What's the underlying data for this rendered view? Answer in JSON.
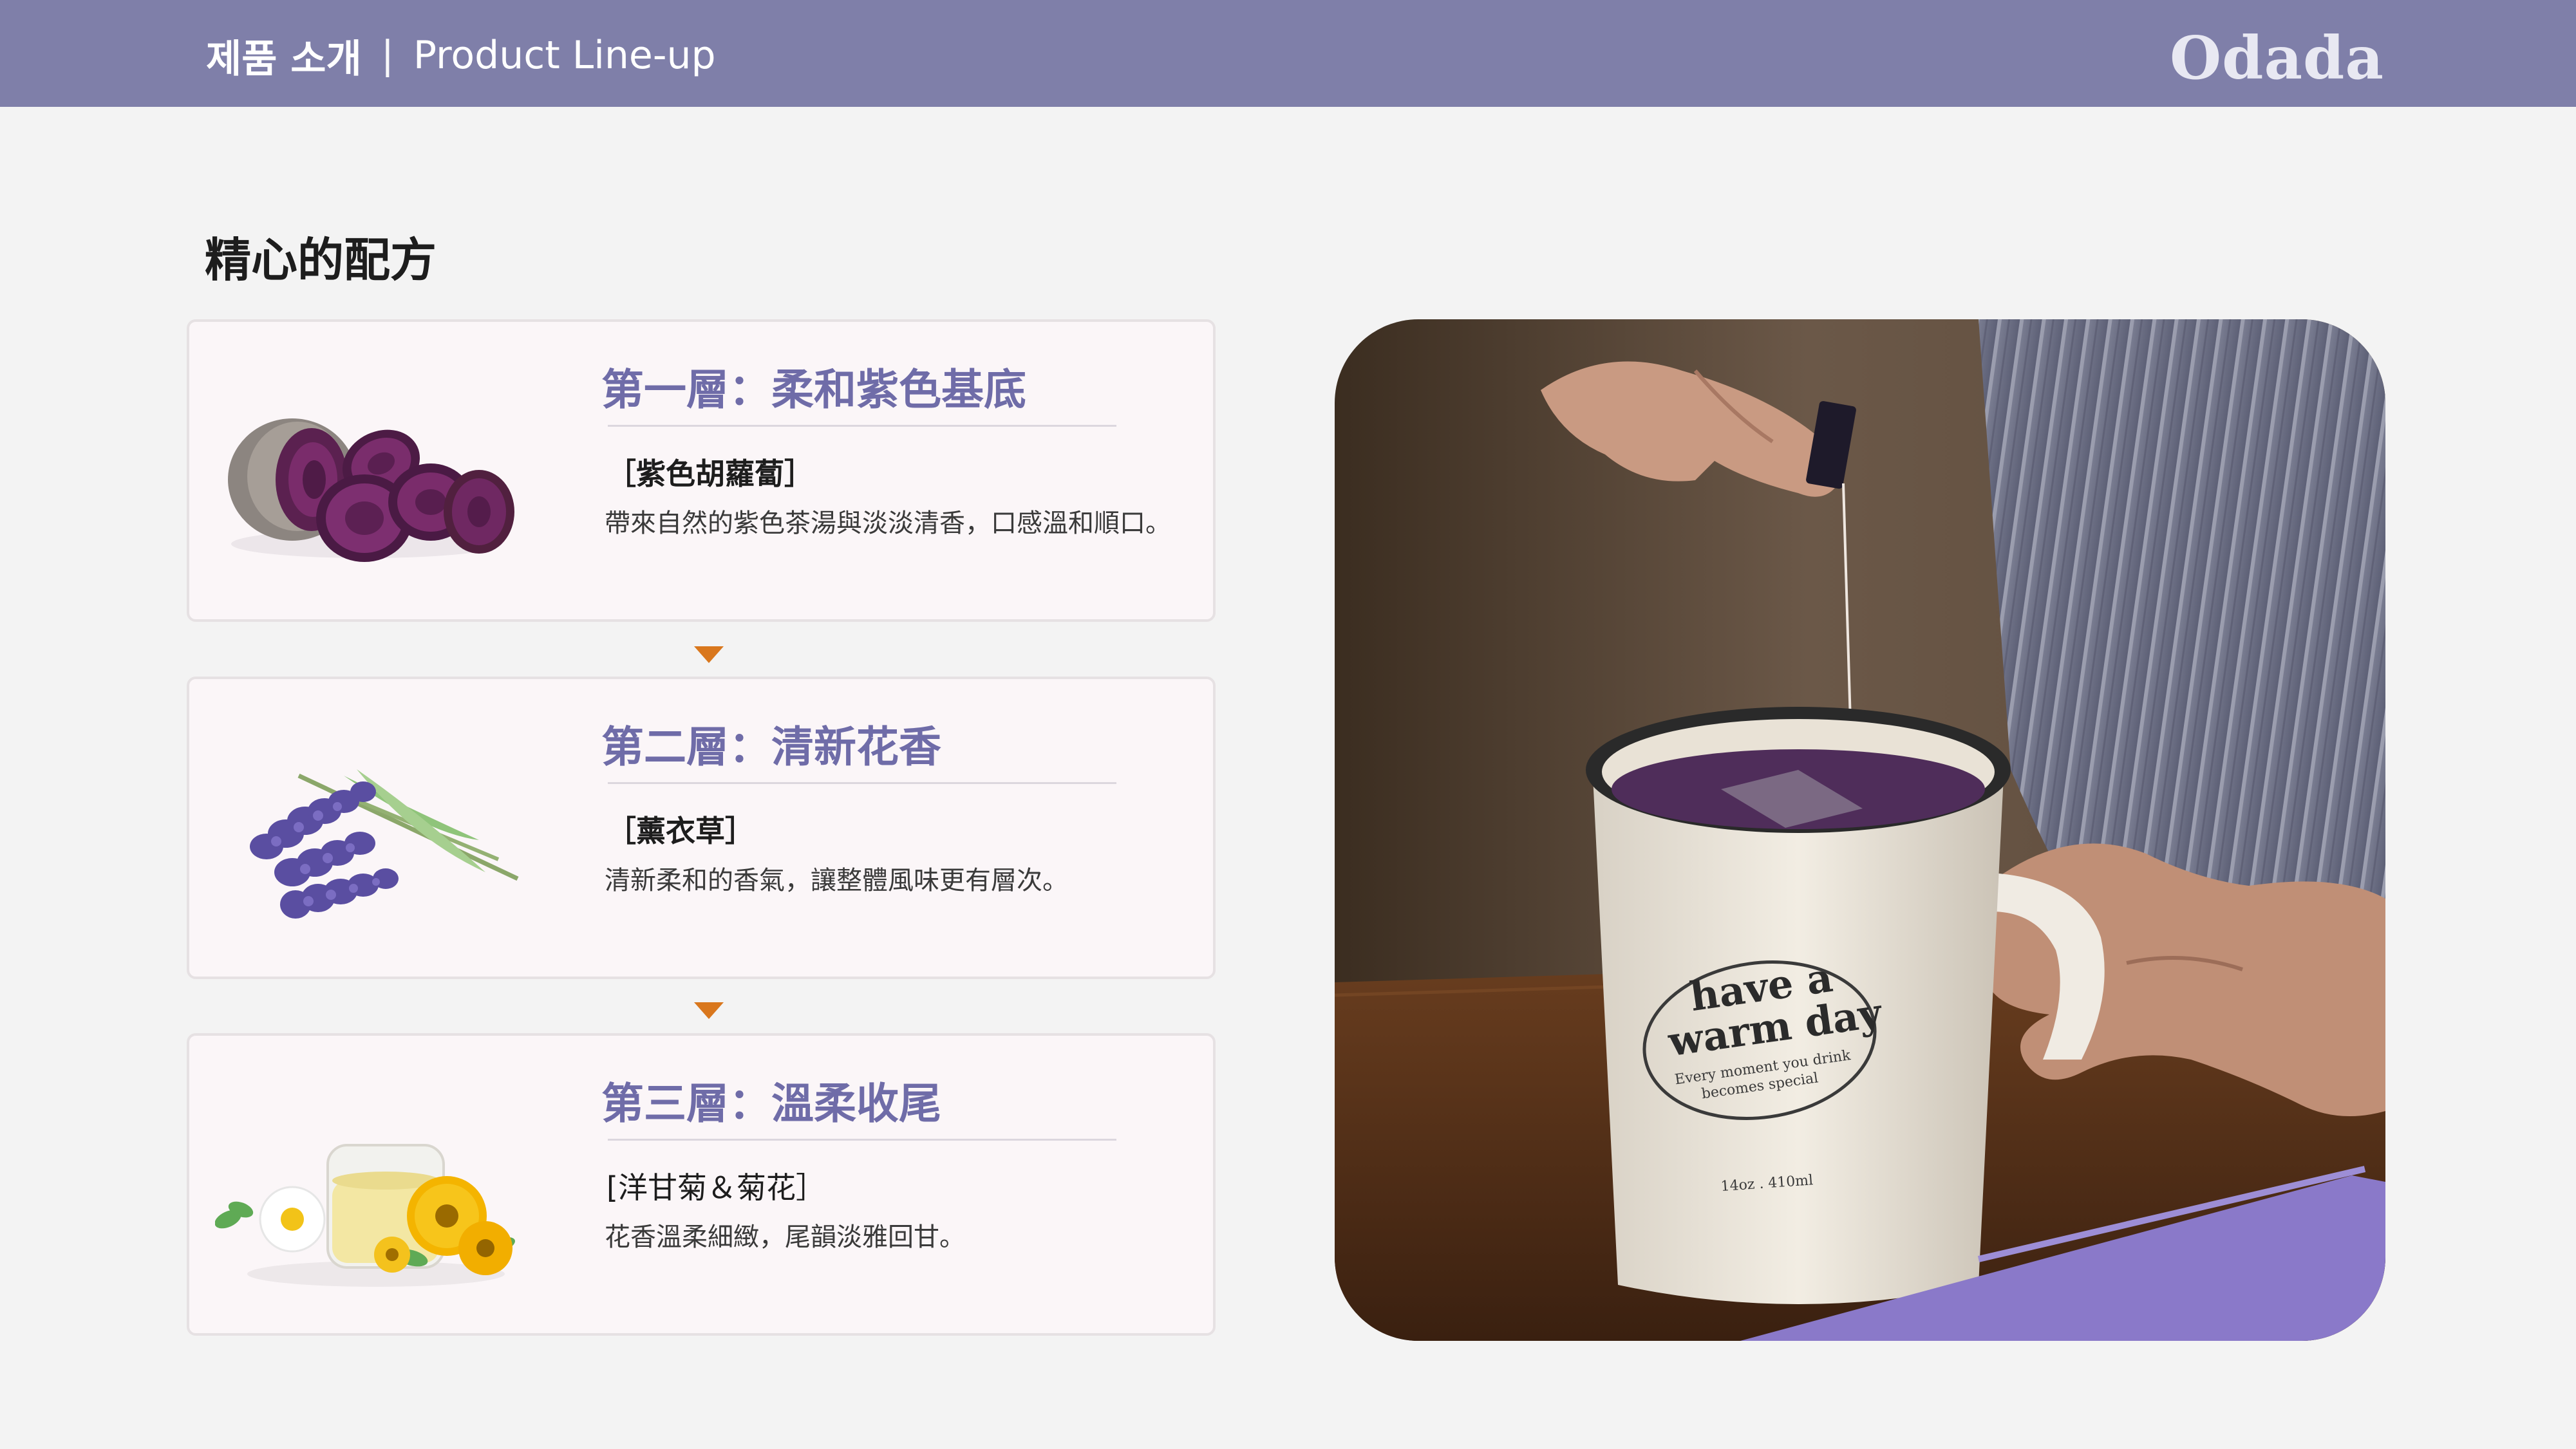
{
  "header": {
    "section_ko": "제품 소개",
    "separator": "|",
    "section_en": "Product Line-up",
    "brand": "Odada"
  },
  "page_title": "精心的配方",
  "layers": [
    {
      "title": "第一層：柔和紫色基底",
      "ingredient": "［紫色胡蘿蔔］",
      "description": "帶來自然的紫色茶湯與淡淡清香，口感溫和順口。",
      "image": "purple-carrot"
    },
    {
      "title": "第二層：清新花香",
      "ingredient": "［薰衣草］",
      "description": "清新柔和的香氣，讓整體風味更有層次。",
      "image": "lavender"
    },
    {
      "title": "第三層：溫柔收尾",
      "ingredient": "[洋甘菊＆菊花］",
      "description": "花香溫柔細緻，尾韻淡雅回甘。",
      "image": "chamomile-tea"
    }
  ],
  "photo": {
    "mug_text_1": "have a",
    "mug_text_2": "warm day",
    "mug_text_3": "Every moment you drink",
    "mug_text_4": "becomes special",
    "mug_text_5": "14oz . 410ml"
  },
  "colors": {
    "header_bg": "#7f7fa9",
    "accent_purple": "#6f6ca8",
    "arrow": "#d9771d"
  }
}
